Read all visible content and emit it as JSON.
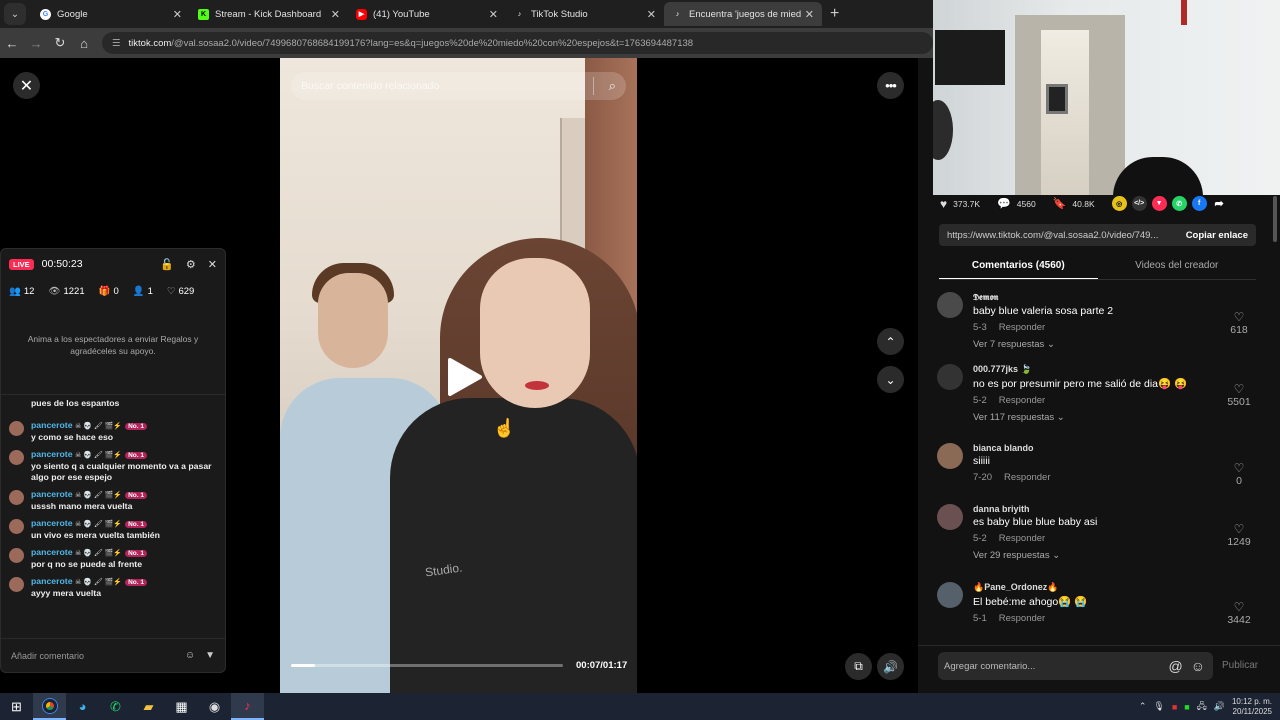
{
  "browser": {
    "tabs": [
      {
        "label": "Google",
        "icon": "google-icon",
        "color": "#ffffff"
      },
      {
        "label": "Stream - Kick Dashboard",
        "icon": "kick-icon",
        "color": "#53fc18"
      },
      {
        "label": "(41) YouTube",
        "icon": "youtube-icon",
        "color": "#ff0000"
      },
      {
        "label": "TikTok Studio",
        "icon": "tiktok-icon",
        "color": "#000000"
      },
      {
        "label": "Encuentra 'juegos de miedo co",
        "icon": "tiktok-icon",
        "color": "#000000",
        "active": true
      }
    ],
    "url_domain": "tiktok.com",
    "url_path": "/@val.sosaa2.0/video/7499680768684199176?lang=es&q=juegos%20de%20miedo%20con%20espejos&t=1763694487138"
  },
  "video": {
    "search_placeholder": "Buscar contenido relacionado",
    "shirt_text": "Studio.",
    "time": "00:07/01:17",
    "progress": 0.09
  },
  "live_panel": {
    "badge": "LIVE",
    "duration": "00:50:23",
    "stats": {
      "viewers_now": "12",
      "views": "1221",
      "gifts": "0",
      "followers": "1",
      "likes": "629"
    },
    "gift_note": "Anima a los espectadores a enviar Regalos y agradéceles su apoyo.",
    "first_msg": "pues de los espantos",
    "username": "pancerote",
    "badges": "☠ 💀 🖌 🎬⚡",
    "rank": "No. 1",
    "messages": [
      "y como se hace eso",
      "yo siento q a cualquier momento va a pasar algo por ese espejo",
      "usssh mano mera vuelta",
      "un vivo es mera vuelta también",
      "por q no se puede al frente",
      "ayyy mera vuelta"
    ],
    "input_placeholder": "Añadir comentario"
  },
  "right_panel": {
    "likes": "373.7K",
    "comments_count": "4560",
    "saves": "40.8K",
    "link": "https://www.tiktok.com/@val.sosaa2.0/video/749...",
    "copy_label": "Copiar enlace",
    "tab_comments": "Comentarios (4560)",
    "tab_creator": "Videos del creador",
    "comments": [
      {
        "user": "𝕯𝖊𝖒𝖔𝖓",
        "text": "baby blue valeria sosa parte 2",
        "date": "5-3",
        "reply": "Responder",
        "replies": "Ver 7 respuestas",
        "likes": "618",
        "avatar": "#4a4a4a"
      },
      {
        "user": "000.777jks 🍃",
        "text": "no es por presumir pero me salió de dia😝 😝",
        "date": "5-2",
        "reply": "Responder",
        "replies": "Ver 117 respuestas",
        "likes": "5501",
        "avatar": "#333333"
      },
      {
        "user": "bianca blando",
        "text": "siiiii",
        "date": "7-20",
        "reply": "Responder",
        "replies": "",
        "likes": "0",
        "avatar": "#8a6a55"
      },
      {
        "user": "danna briyith",
        "text": "es baby blue blue baby asi",
        "date": "5-2",
        "reply": "Responder",
        "replies": "Ver 29 respuestas",
        "likes": "1249",
        "avatar": "#6a5050"
      },
      {
        "user": "🔥Pane_Ordonez🔥",
        "text": "El bebé:me ahogo😭 😭",
        "date": "5-1",
        "reply": "Responder",
        "replies": "",
        "likes": "3442",
        "avatar": "#55606a"
      }
    ],
    "add_comment_placeholder": "Agregar comentario...",
    "publish_label": "Publicar"
  },
  "taskbar": {
    "time": "10:12 p. m.",
    "date": "20/11/2025"
  }
}
